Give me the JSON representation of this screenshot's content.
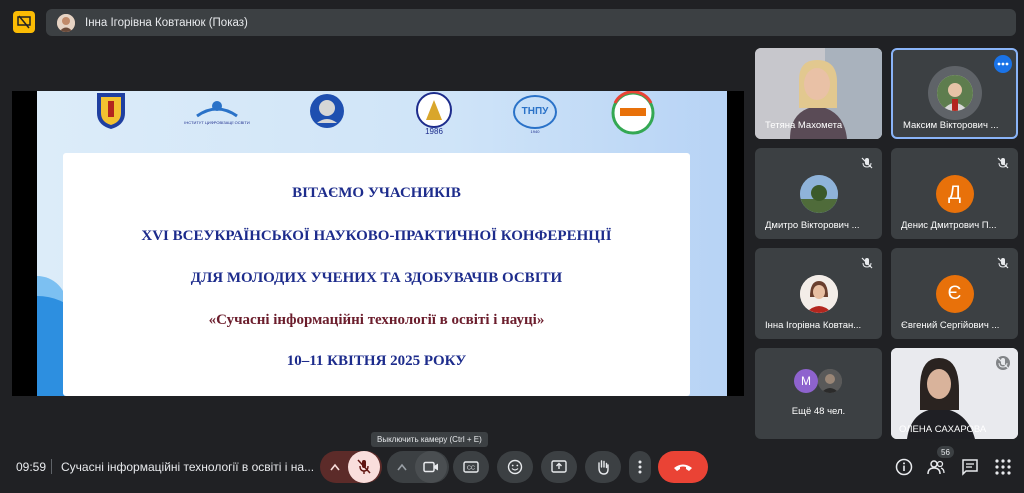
{
  "top_bar": {
    "title": "Інна Ігорівна Ковтанюк (Показ)"
  },
  "slide": {
    "line1": "ВІТАЄМО УЧАСНИКІВ",
    "line2": "XVI ВСЕУКРАЇНСЬКОЇ НАУКОВО-ПРАКТИЧНОЇ КОНФЕРЕНЦІЇ",
    "line3": "ДЛЯ МОЛОДИХ УЧЕНИХ ТА ЗДОБУВАЧІВ ОСВІТИ",
    "line4": "«Сучасні інформаційні технології в освіті і науці»",
    "line5": "10–11 КВІТНЯ 2025 РОКУ",
    "logos": [
      "ІНСТИТУТ ЦИФРОВІЗАЦІЇ ОСВІТИ",
      "1986",
      "ТНПУ",
      "1940"
    ]
  },
  "participants": [
    {
      "name": "Тетяна Махомета",
      "muted": false
    },
    {
      "name": "Максим Вікторович ...",
      "muted": false,
      "has_menu": true
    },
    {
      "name": "Дмитро Вікторович ...",
      "muted": true
    },
    {
      "name": "Денис Дмитрович П...",
      "muted": true,
      "initial": "Д",
      "color": "#e8710a"
    },
    {
      "name": "Інна Ігорівна Ковтан...",
      "muted": true
    },
    {
      "name": "Євгений Сергійович ...",
      "muted": true,
      "initial": "Є",
      "color": "#e8710a"
    },
    {
      "name": "Ещё 48 чел.",
      "initial": "M",
      "color": "#8e63ce"
    },
    {
      "name": "ОЛЕНА САХАРОВА",
      "muted": true
    }
  ],
  "bottom_bar": {
    "time": "09:59",
    "meeting_title": "Сучасні інформаційні технології в освіті і на...",
    "tooltip": "Выключить камеру (Ctrl + E)",
    "participant_count": "56"
  },
  "colors": {
    "background": "#202124",
    "button": "#3c4043",
    "mic_off": "#f9dedc",
    "end_call": "#ea4335",
    "accent": "#fbbc04"
  }
}
